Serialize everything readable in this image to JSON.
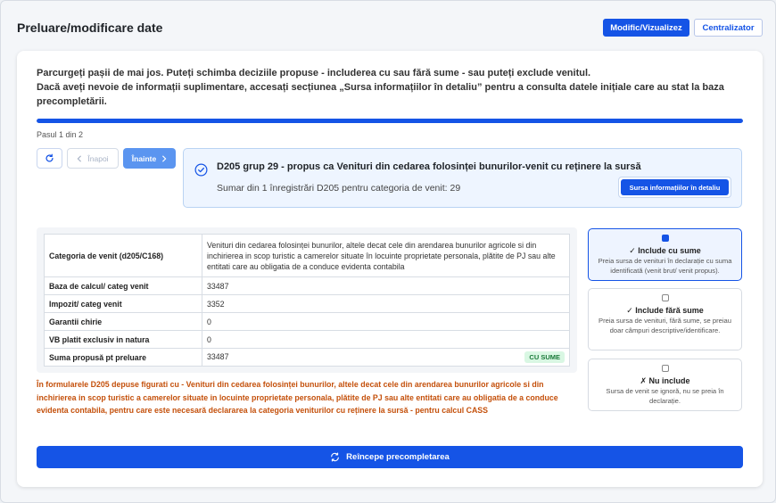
{
  "header": {
    "title": "Preluare/modificare date",
    "primary_button": "Modific/Vizualizez",
    "secondary_button": "Centralizator"
  },
  "intro": {
    "line1": "Parcurgeți pașii de mai jos. Puteți schimba deciziile propuse - includerea cu sau fără sume - sau puteți exclude venitul.",
    "line2": "Dacă aveți nevoie de informații suplimentare, accesați secțiunea „Sursa informațiilor în detaliu” pentru a consulta datele inițiale care au stat la baza precompletării."
  },
  "progress": {
    "fraction": 1.0,
    "step_label": "Pasul 1 din 2"
  },
  "nav": {
    "reset_icon": "refresh-icon",
    "back_label": "Înapoi",
    "next_label": "Înainte"
  },
  "info": {
    "title": "D205 grup 29 - propus ca Venituri din cedarea folosinței bunurilor-venit cu reținere la sursă",
    "subtitle": "Sumar din 1 înregistrări D205 pentru categoria de venit: 29",
    "button": "Sursa informațiilor în detaliu"
  },
  "table": {
    "rows": [
      {
        "label": "Categoria de venit (d205/C168)",
        "value": "Venituri din cedarea folosinței bunurilor, altele decat cele din arendarea bunurilor agricole si din inchirierea in scop turistic a camerelor situate în locuinte proprietate personala, plătite de PJ sau alte entitati care au obligatia de a conduce evidenta contabila"
      },
      {
        "label": "Baza de calcul/ categ venit",
        "value": "33487"
      },
      {
        "label": "Impozit/ categ venit",
        "value": "3352"
      },
      {
        "label": "Garantii chirie",
        "value": "0"
      },
      {
        "label": "VB platit exclusiv in natura",
        "value": "0"
      },
      {
        "label": "Suma propusă pt preluare",
        "value": "33487",
        "badge": "CU SUME"
      }
    ]
  },
  "warning": "În formularele D205 depuse figurati cu - Venituri din cedarea folosinței bunurilor, altele decat cele din arendarea bunurilor agricole si din inchirierea in scop turistic a camerelor situate in locuinte proprietate personala, plătite de PJ sau alte entitati care au obligatia de a conduce evidenta contabila, pentru care este necesară declararea la categoria veniturilor cu reținere la sursă - pentru calcul CASS",
  "options": [
    {
      "title": "✓ Include cu sume",
      "desc": "Preia sursa de venituri în declarație cu suma identificată (venit brut/ venit propus).",
      "selected": true
    },
    {
      "title": "✓ Include fără sume",
      "desc": "Preia sursa de venituri, fără sume, se preiau doar câmpuri descriptive/identificare.",
      "selected": false
    },
    {
      "title": "✗ Nu include",
      "desc": "Sursa de venit se ignoră, nu se preia în declarație.",
      "selected": false
    }
  ],
  "restart_label": "Reîncepe precompletarea",
  "colors": {
    "accent": "#1554e6",
    "warning": "#c4500b",
    "badge_bg": "#d9f7e3"
  }
}
